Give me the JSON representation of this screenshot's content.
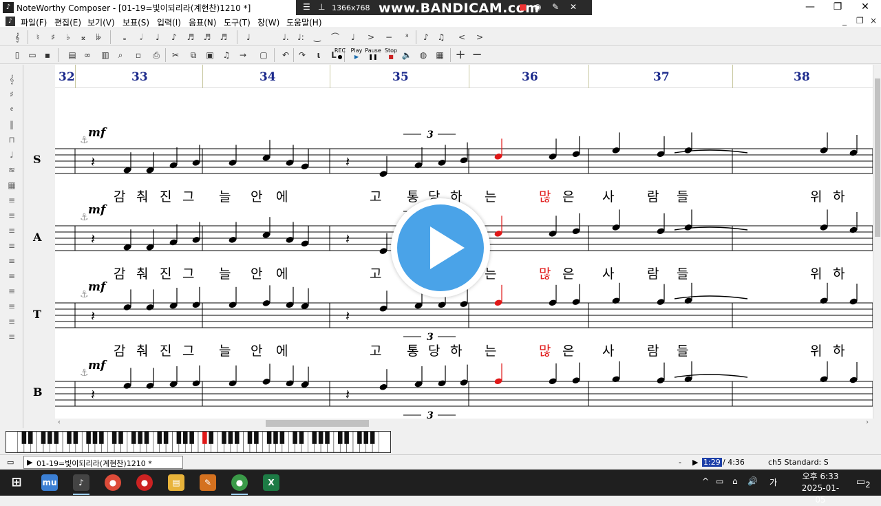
{
  "window": {
    "title": "NoteWorthy Composer - [01-19=빛이되리라(계현찬)1210 *]",
    "controls": [
      "—",
      "❐",
      "✕"
    ]
  },
  "recorder": {
    "resolution": "1366x768",
    "brand": "www.BANDICAM.com"
  },
  "menu": {
    "items": [
      "파일(F)",
      "편집(E)",
      "보기(V)",
      "보표(S)",
      "입력(I)",
      "음표(N)",
      "도구(T)",
      "창(W)",
      "도움말(H)"
    ],
    "mdi_controls": [
      "_",
      "❐",
      "×"
    ]
  },
  "toolbar_play": {
    "rec": "REC",
    "play": "Play",
    "pause": "Pause",
    "stop": "Stop"
  },
  "ruler": {
    "measures": [
      "32",
      "33",
      "34",
      "35",
      "36",
      "37",
      "38"
    ]
  },
  "staves": [
    {
      "name": "S",
      "dynamic": "mf",
      "lyrics": [
        "감",
        "춰",
        "진",
        "그",
        "늘",
        "안",
        "에",
        "고",
        "통",
        "당",
        "하",
        "는",
        "많",
        "은",
        "사",
        "람",
        "들",
        "위",
        "하"
      ]
    },
    {
      "name": "A",
      "dynamic": "mf",
      "lyrics": [
        "감",
        "춰",
        "진",
        "그",
        "늘",
        "안",
        "에",
        "고",
        "통",
        "당",
        "하",
        "는",
        "많",
        "은",
        "사",
        "람",
        "들",
        "위",
        "하"
      ]
    },
    {
      "name": "T",
      "dynamic": "mf",
      "lyrics": [
        "감",
        "춰",
        "진",
        "그",
        "늘",
        "안",
        "에",
        "고",
        "통",
        "당",
        "하",
        "는",
        "많",
        "은",
        "사",
        "람",
        "들",
        "위",
        "하"
      ]
    },
    {
      "name": "B",
      "dynamic": "mf",
      "lyrics": []
    }
  ],
  "triplet_label": "3",
  "status": {
    "file_tab": "01-19=빛이되리라(계현찬)1210 *",
    "dash": "-",
    "current_time": "1:29",
    "total_time": "/ 4:36",
    "channel": "ch5 Standard: S"
  },
  "taskbar": {
    "apps": [
      {
        "name": "windows-start",
        "label": "⊞",
        "color": "#1f1f1f"
      },
      {
        "name": "mu-app",
        "label": "mu",
        "color": "#3b7fd4"
      },
      {
        "name": "noteworthy-app",
        "label": "♪",
        "color": "#333333"
      },
      {
        "name": "chrome-app",
        "label": "●",
        "color": "#3a9a48"
      },
      {
        "name": "record-app",
        "label": "●",
        "color": "#cc2222"
      },
      {
        "name": "explorer-app",
        "label": "▤",
        "color": "#e8b33a"
      },
      {
        "name": "pencil-app",
        "label": "✎",
        "color": "#d4711f"
      },
      {
        "name": "chrome2-app",
        "label": "●",
        "color": "#3a9a48"
      },
      {
        "name": "excel-app",
        "label": "X",
        "color": "#1d7b45"
      }
    ],
    "tray": [
      "^",
      "▭",
      "⌂",
      "🔊",
      "가"
    ],
    "time": "오후 6:33",
    "date": "2025-01-05",
    "notifications": "2"
  },
  "colors": {
    "measure_numbers": "#1c2a8c",
    "highlight_note": "#e01818",
    "selected_staff": "#1a27b8",
    "play_button": "#4aa3e8"
  }
}
